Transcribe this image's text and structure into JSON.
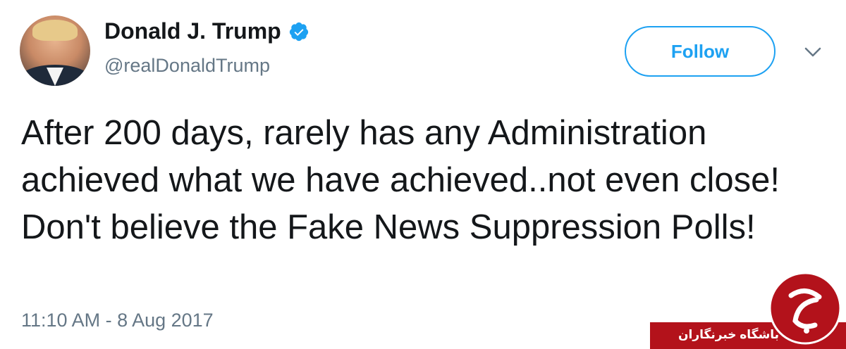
{
  "author": {
    "display_name": "Donald J. Trump",
    "handle": "@realDonaldTrump",
    "verified": true
  },
  "actions": {
    "follow_label": "Follow"
  },
  "tweet": {
    "text": "After 200 days, rarely has any Administration achieved what we have achieved..not even close! Don't believe the Fake News Suppression Polls!",
    "timestamp": "11:10 AM - 8 Aug 2017"
  },
  "watermark": {
    "text": "باشگاه خبرنگاران"
  },
  "colors": {
    "accent": "#1da1f2",
    "text": "#14171a",
    "secondary_text": "#657786",
    "watermark_red": "#b3121b"
  },
  "icons": {
    "verified": "verified-badge-icon",
    "chevron": "chevron-down-icon"
  }
}
